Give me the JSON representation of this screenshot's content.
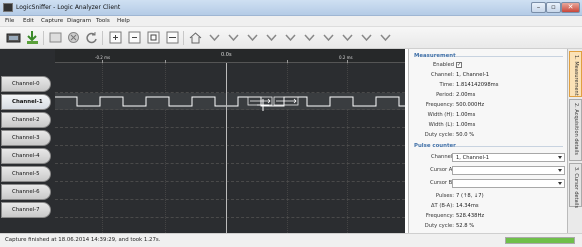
{
  "window": {
    "title": "LogicSniffer - Logic Analyzer Client"
  },
  "menu": [
    "File",
    "Edit",
    "Capture",
    "Diagram",
    "Tools",
    "Help"
  ],
  "toolbar": {
    "icons": [
      "capture-icon",
      "download-icon",
      "repeat-capture-icon",
      "abort-icon",
      "refresh-icon",
      "zoom-in-icon",
      "zoom-out-icon",
      "zoom-default-icon",
      "zoom-fit-icon",
      "trigger-home-icon",
      "goto-cursor-1-icon",
      "goto-cursor-2-icon",
      "goto-cursor-3-icon",
      "goto-cursor-4-icon",
      "goto-cursor-5-icon",
      "goto-cursor-6-icon",
      "goto-cursor-7-icon",
      "goto-cursor-8-icon",
      "goto-cursor-9-icon",
      "goto-cursor-10-icon"
    ]
  },
  "timeline": {
    "left_label": "-0.2 ms",
    "center_label": "0.0s",
    "right_label": "0.2 ms"
  },
  "channels": [
    "Channel-0",
    "Channel-1",
    "Channel-2",
    "Channel-3",
    "Channel-4",
    "Channel-5",
    "Channel-6",
    "Channel-7"
  ],
  "selected_channel": 1,
  "measurement": {
    "title": "Measurement",
    "enabled_label": "Enabled",
    "enabled": true,
    "rows": [
      {
        "label": "Channel:",
        "value": "1, Channel-1"
      },
      {
        "label": "Time:",
        "value": "1.814142098ms"
      },
      {
        "label": "Period:",
        "value": "2.00ms"
      },
      {
        "label": "Frequency:",
        "value": "500.000Hz"
      },
      {
        "label": "Width (H):",
        "value": "1.00ms"
      },
      {
        "label": "Width (L):",
        "value": "1.00ms"
      },
      {
        "label": "Duty cycle:",
        "value": "50.0 %"
      }
    ]
  },
  "pulse_counter": {
    "title": "Pulse counter",
    "channel_label": "Channel:",
    "channel_value": "1, Channel-1",
    "cursor_a_label": "Cursor A:",
    "cursor_a_value": "",
    "cursor_b_label": "Cursor B:",
    "cursor_b_value": "",
    "rows": [
      {
        "label": "Pulses:",
        "value": "7 (↑8, ↓7)"
      },
      {
        "label": "ΔT (B-A):",
        "value": "14.34ms"
      },
      {
        "label": "Frequency:",
        "value": "528.438Hz"
      },
      {
        "label": "Duty cycle:",
        "value": "52.8 %"
      }
    ]
  },
  "side_tabs": [
    "1. Measurement",
    "2. Acquisition details",
    "3. Cursor details"
  ],
  "status": {
    "text": "Capture finished at 18.06.2014 14:39:29, and took 1.27s.",
    "progress": 1.0
  },
  "colors": {
    "canvas_bg": "#2b2d30",
    "signal": "#ffffff",
    "accent": "#3f6fa7",
    "active_tab": "#fbe2b7"
  }
}
